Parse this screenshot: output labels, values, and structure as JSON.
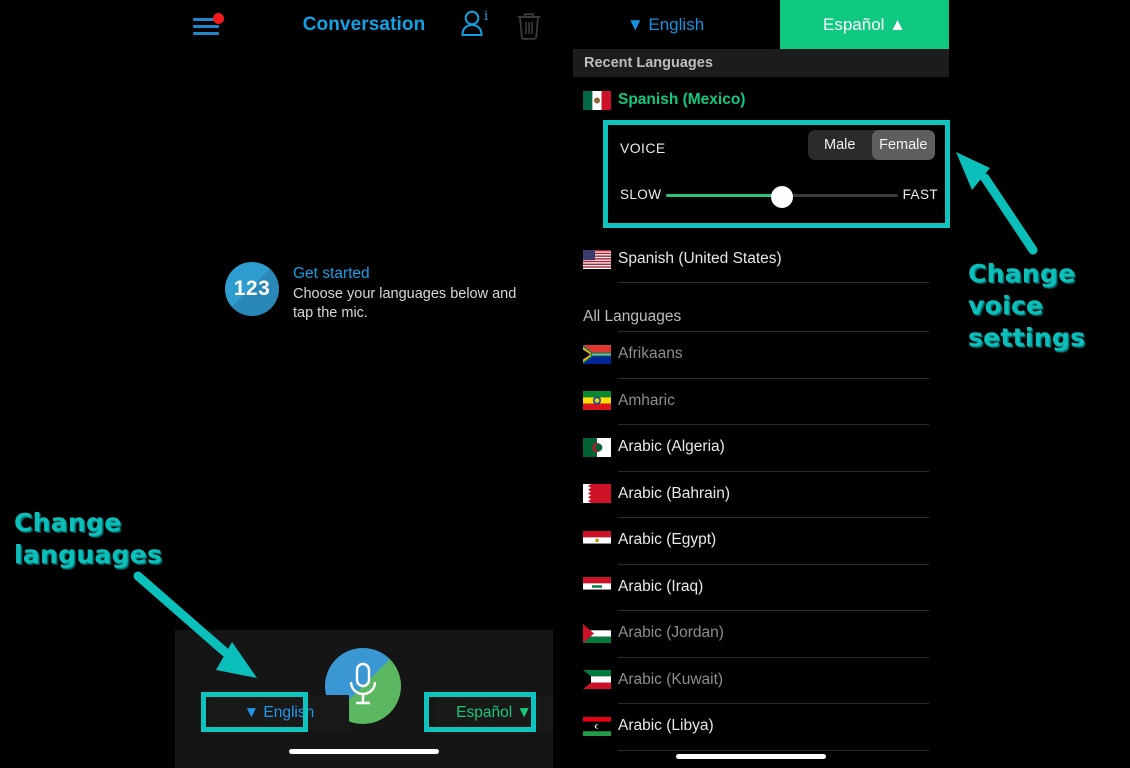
{
  "app": {
    "header_title": "Conversation",
    "accent_blue": "#13a0e5",
    "accent_green": "#0ec97f",
    "annotation_color": "#0bbfbb"
  },
  "topbar": {
    "menu_icon": "hamburger-menu-icon",
    "menu_badge": "notification-dot",
    "title": "Conversation",
    "person_info_icon": "person-info-icon",
    "trash_icon": "trash-icon"
  },
  "main": {
    "get_started": {
      "badge": "123",
      "title": "Get started",
      "description": "Choose your languages below and tap the mic."
    }
  },
  "bottom_bar": {
    "mic_icon": "microphone-icon",
    "source_language": "▼ English",
    "target_language": "Español ▼",
    "home_indicator": "home-indicator"
  },
  "language_panel": {
    "source_language": "▼ English",
    "mic_icon": "microphone-icon",
    "target_language": "Español ▲",
    "recent_header": "Recent Languages",
    "all_header": "All Languages",
    "recent": [
      {
        "name": "Spanish (Mexico)",
        "flag": "mx",
        "selected": true,
        "enabled": true
      },
      {
        "name": "Spanish (United States)",
        "flag": "us",
        "selected": false,
        "enabled": true
      }
    ],
    "all": [
      {
        "name": "Afrikaans",
        "flag": "za",
        "enabled": false
      },
      {
        "name": "Amharic",
        "flag": "et",
        "enabled": false
      },
      {
        "name": "Arabic (Algeria)",
        "flag": "dz",
        "enabled": true
      },
      {
        "name": "Arabic (Bahrain)",
        "flag": "bh",
        "enabled": true
      },
      {
        "name": "Arabic (Egypt)",
        "flag": "eg",
        "enabled": true
      },
      {
        "name": "Arabic (Iraq)",
        "flag": "iq",
        "enabled": true
      },
      {
        "name": "Arabic (Jordan)",
        "flag": "jo",
        "enabled": false
      },
      {
        "name": "Arabic (Kuwait)",
        "flag": "kw",
        "enabled": false
      },
      {
        "name": "Arabic (Libya)",
        "flag": "ly",
        "enabled": true
      }
    ]
  },
  "voice_settings": {
    "label": "VOICE",
    "options": [
      "Male",
      "Female"
    ],
    "selected": "Female",
    "slow_label": "SLOW",
    "fast_label": "FAST",
    "speed_percent": 50
  },
  "annotations": [
    {
      "text": "Change voice settings",
      "target": "voice-settings-panel"
    },
    {
      "text": "Change languages",
      "target": "language-buttons"
    }
  ],
  "annotation_voice": {
    "line1": "Change",
    "line2": "voice",
    "line3": "settings"
  },
  "annotation_lang": {
    "line1": "Change",
    "line2": "languages"
  }
}
